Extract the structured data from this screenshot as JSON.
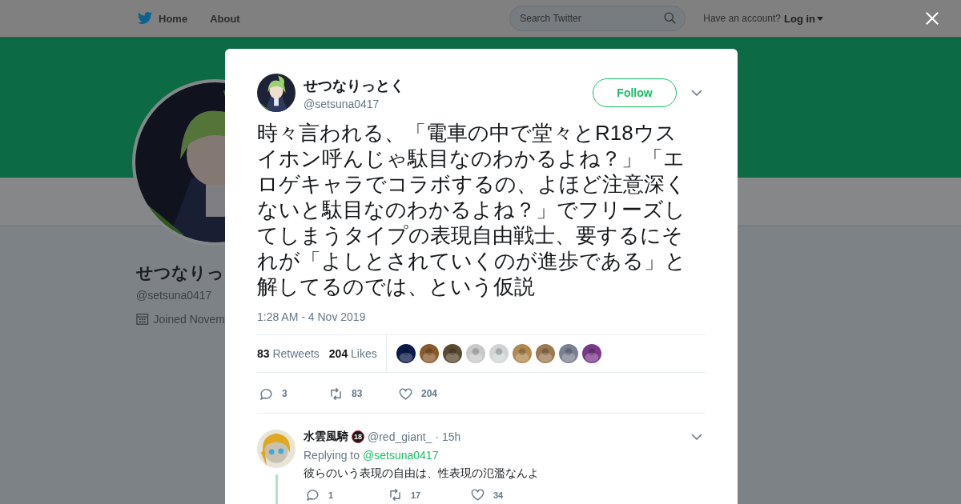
{
  "topbar": {
    "nav": [
      {
        "label": "Home"
      },
      {
        "label": "About"
      }
    ],
    "search": {
      "placeholder": "Search Twitter"
    },
    "account_prompt": "Have an account?",
    "login": "Log in"
  },
  "profile": {
    "name": "せつなりっ",
    "handle": "@setsuna0417",
    "joined": "Joined Novem"
  },
  "tweet": {
    "name": "せつなりっとく",
    "handle": "@setsuna0417",
    "follow": "Follow",
    "text": "時々言われる、「電車の中で堂々とR18ウスイホン呼んじゃ駄目なのわかるよね？」「エロゲキャラでコラボするの、よほど注意深くないと駄目なのわかるよね？」でフリーズしてしまうタイプの表現自由戦士、要するにそれが「よしとされていくのが進歩である」と解してるのでは、という仮説",
    "time": "1:28 AM - 4 Nov 2019",
    "retweets_count": "83",
    "retweets_label": "Retweets",
    "likes_count": "204",
    "likes_label": "Likes",
    "likers": [
      {
        "color": "#0a1a4a"
      },
      {
        "color": "#8a5a2a"
      },
      {
        "color": "#5a4a30"
      },
      {
        "color": "#c8c8c8"
      },
      {
        "color": "#d0d4d4"
      },
      {
        "color": "#b08850"
      },
      {
        "color": "#9a7a50"
      },
      {
        "color": "#7a8090"
      },
      {
        "color": "#7a3a8a"
      }
    ],
    "actions": [
      {
        "kind": "reply",
        "count": "3"
      },
      {
        "kind": "retweet",
        "count": "83"
      },
      {
        "kind": "like",
        "count": "204"
      }
    ]
  },
  "replies": [
    {
      "name": "水雲風騎",
      "badge": "18",
      "handle": "@red_giant_",
      "time": "· 15h",
      "replying_label": "Replying to",
      "replying_to": "@setsuna0417",
      "text": "彼らのいう表現の自由は、性表現の氾濫なんよ",
      "actions": [
        {
          "kind": "reply",
          "count": "1"
        },
        {
          "kind": "retweet",
          "count": "17"
        },
        {
          "kind": "like",
          "count": "34"
        }
      ]
    }
  ]
}
